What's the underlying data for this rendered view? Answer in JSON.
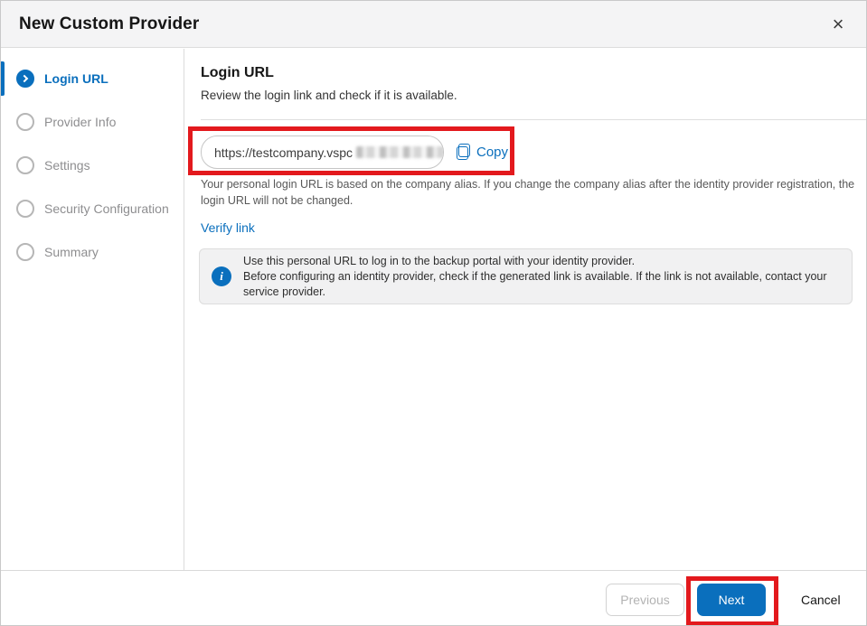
{
  "dialog": {
    "title": "New Custom Provider",
    "close_glyph": "×"
  },
  "steps": [
    {
      "label": "Login URL",
      "active": true
    },
    {
      "label": "Provider Info",
      "active": false
    },
    {
      "label": "Settings",
      "active": false
    },
    {
      "label": "Security Configuration",
      "active": false
    },
    {
      "label": "Summary",
      "active": false
    }
  ],
  "content": {
    "heading": "Login URL",
    "subheading": "Review the login link and check if it is available.",
    "url_value": "https://testcompany.vspc",
    "url_redacted": true,
    "copy_label": "Copy",
    "url_note": "Your personal login URL is based on the company alias. If you change the company alias after the identity provider registration, the login URL will not be changed.",
    "verify_link_label": "Verify link",
    "info_line1": "Use this personal URL to log in to the backup portal with your identity provider.",
    "info_line2": "Before configuring an identity provider, check if the generated link is available. If the link is not available, contact your service provider."
  },
  "footer": {
    "previous_label": "Previous",
    "next_label": "Next",
    "cancel_label": "Cancel"
  },
  "colors": {
    "accent_blue": "#0a6fbd",
    "annotation_red": "#e3191d",
    "header_bg": "#f4f4f5",
    "info_box_bg": "#f1f1f2",
    "inactive_step_gray": "#8e8e90"
  }
}
